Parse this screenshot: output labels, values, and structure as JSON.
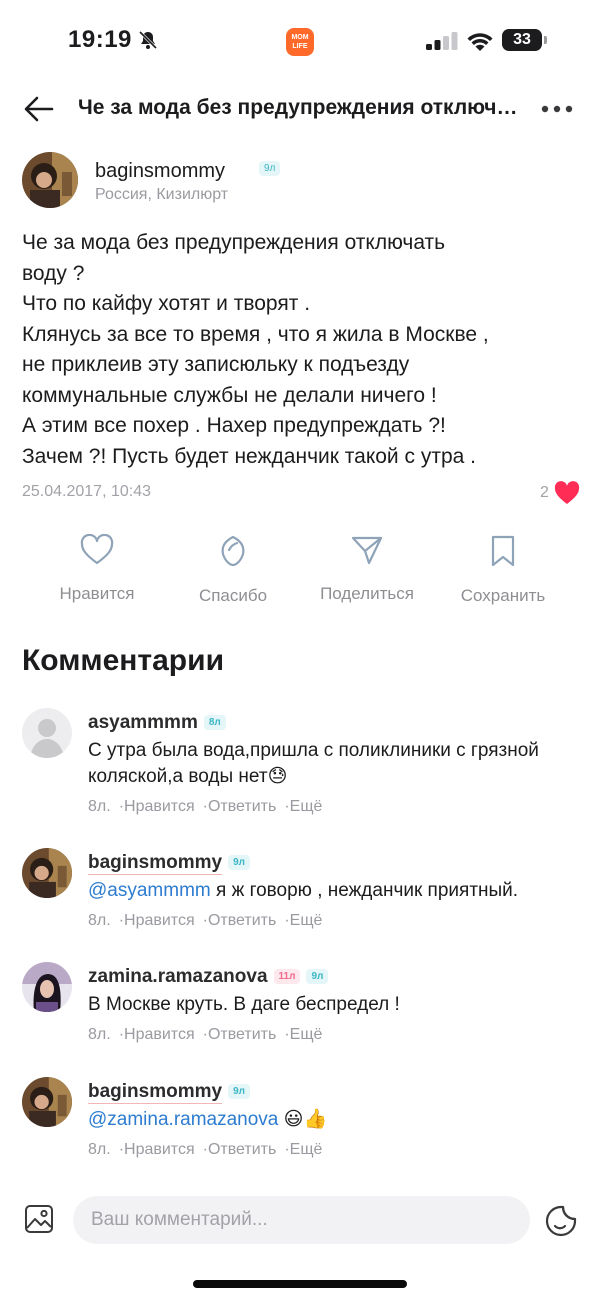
{
  "status_bar": {
    "time": "19:19",
    "battery": "33",
    "app_badge_line1": "MOM",
    "app_badge_line2": "LIFE"
  },
  "header": {
    "title": "Че за мода без предупреждения отключать воду ?"
  },
  "post": {
    "author": "baginsmommy",
    "author_badge": "9л",
    "location": "Россия, Кизилюрт",
    "body_lines": [
      "Че за мода без предупреждения отключать",
      "воду ?",
      "Что по кайфу хотят и творят .",
      "Клянусь за все то время , что я жила в Москве ,",
      "не приклеив эту записюльку к подъезду",
      "коммунальные службы не делали ничего !",
      "А этим все похер . Нахер предупреждать ?!",
      "Зачем ?! Пусть будет нежданчик такой с утра ."
    ],
    "date": "25.04.2017, 10:43",
    "likes": "2"
  },
  "actions": {
    "like": "Нравится",
    "thanks": "Спасибо",
    "share": "Поделиться",
    "save": "Сохранить"
  },
  "comments_title": "Комментарии",
  "comments": [
    {
      "author": "asyammmm",
      "badges": [
        "8л"
      ],
      "text": "С утра была вода,пришла с поликлиники с грязной коляской,а воды нет😓",
      "mention": "",
      "age": "8л.",
      "like": "Нравится",
      "reply": "Ответить",
      "more": "Ещё"
    },
    {
      "author": "baginsmommy",
      "badges": [
        "9л"
      ],
      "text": " я ж говорю , нежданчик приятный.",
      "mention": "@asyammmm",
      "age": "8л.",
      "like": "Нравится",
      "reply": "Ответить",
      "more": "Ещё"
    },
    {
      "author": "zamina.ramazanova",
      "badges": [
        "11л",
        "9л"
      ],
      "text": "В Москве круть. В даге беспредел !",
      "mention": "",
      "age": "8л.",
      "like": "Нравится",
      "reply": "Ответить",
      "more": "Ещё"
    },
    {
      "author": "baginsmommy",
      "badges": [
        "9л"
      ],
      "text": " 😃👍",
      "mention": "@zamina.ramazanova",
      "age": "8л.",
      "like": "Нравится",
      "reply": "Ответить",
      "more": "Ещё"
    }
  ],
  "input": {
    "placeholder": "Ваш комментарий..."
  },
  "colors": {
    "accent_heart": "#ff2d55",
    "badge_teal": "#3bb6c5",
    "badge_pink": "#f06a8a",
    "mention_blue": "#2d7ccf"
  },
  "icons": [
    "bell-off-icon",
    "signal-icon",
    "wifi-icon",
    "battery-icon",
    "back-arrow-icon",
    "more-icon",
    "heart-icon",
    "thanks-icon",
    "share-icon",
    "bookmark-icon",
    "image-icon",
    "sticker-icon"
  ]
}
